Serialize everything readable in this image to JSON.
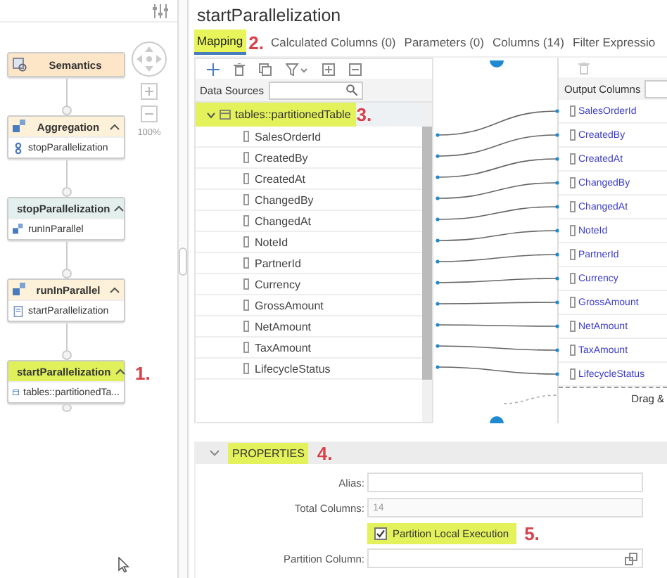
{
  "canvas": {
    "nodes": [
      {
        "title": "Semantics",
        "kind": "semantics",
        "highlighted": false
      },
      {
        "title": "Aggregation",
        "kind": "aggregation",
        "highlighted": false,
        "expanded": true,
        "items": [
          {
            "label": "stopParallelization",
            "kind": "stop"
          }
        ]
      },
      {
        "title": "stopParallelization",
        "kind": "stop",
        "highlighted": false,
        "expanded": true,
        "items": [
          {
            "label": "runInParallel",
            "kind": "aggregation"
          }
        ]
      },
      {
        "title": "runInParallel",
        "kind": "aggregation",
        "highlighted": false,
        "expanded": true,
        "items": [
          {
            "label": "startParallelization",
            "kind": "doc"
          }
        ]
      },
      {
        "title": "startParallelization",
        "kind": "start",
        "highlighted": true,
        "expanded": true,
        "annotation": "1.",
        "items": [
          {
            "label": "tables::partitionedTa...",
            "kind": "table"
          }
        ]
      }
    ],
    "zoom_label": "100%"
  },
  "editor": {
    "title": "startParallelization",
    "tabs": [
      {
        "label": "Mapping",
        "selected": true,
        "highlighted": true,
        "annotation": "2."
      },
      {
        "label": "Calculated Columns (0)",
        "selected": false,
        "highlighted": false
      },
      {
        "label": "Parameters (0)",
        "selected": false,
        "highlighted": false
      },
      {
        "label": "Columns (14)",
        "selected": false,
        "highlighted": false
      },
      {
        "label": "Filter Expressio",
        "selected": false,
        "highlighted": false
      }
    ],
    "data_sources": {
      "label": "Data Sources",
      "source": "tables::partitionedTable",
      "expanded": true,
      "highlighted": true,
      "annotation": "3.",
      "columns": [
        "SalesOrderId",
        "CreatedBy",
        "CreatedAt",
        "ChangedBy",
        "ChangedAt",
        "NoteId",
        "PartnerId",
        "Currency",
        "GrossAmount",
        "NetAmount",
        "TaxAmount",
        "LifecycleStatus"
      ]
    },
    "output": {
      "label": "Output Columns",
      "columns": [
        "SalesOrderId",
        "CreatedBy",
        "CreatedAt",
        "ChangedBy",
        "ChangedAt",
        "NoteId",
        "PartnerId",
        "Currency",
        "GrossAmount",
        "NetAmount",
        "TaxAmount",
        "LifecycleStatus"
      ],
      "drop_hint": "Drag &"
    },
    "properties": {
      "title": "PROPERTIES",
      "expanded": true,
      "highlighted": true,
      "annotation": "4.",
      "fields": [
        {
          "kind": "text",
          "label": "Alias:",
          "disabled": false
        },
        {
          "kind": "text",
          "label": "Total Columns:",
          "value": "14",
          "disabled": true
        },
        {
          "kind": "checkbox",
          "label": "Partition Local Execution",
          "checked": true,
          "highlighted": true,
          "annotation": "5."
        },
        {
          "kind": "picker",
          "label": "Partition Column:",
          "disabled": false
        }
      ]
    }
  }
}
